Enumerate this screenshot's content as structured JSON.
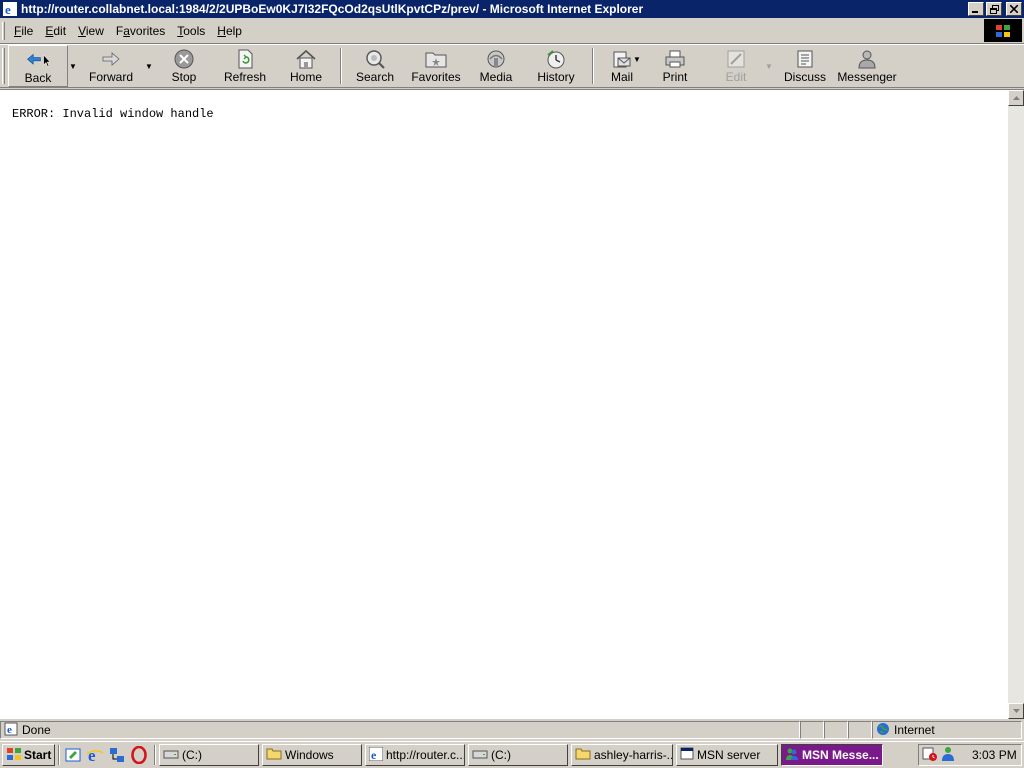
{
  "window": {
    "title": "http://router.collabnet.local:1984/2/2UPBoEw0KJ7I32FQcOd2qsUtlKpvtCPz/prev/ - Microsoft Internet Explorer"
  },
  "menu": {
    "items": [
      {
        "label": "File",
        "accel": "F"
      },
      {
        "label": "Edit",
        "accel": "E"
      },
      {
        "label": "View",
        "accel": "V"
      },
      {
        "label": "Favorites",
        "accel": "a"
      },
      {
        "label": "Tools",
        "accel": "T"
      },
      {
        "label": "Help",
        "accel": "H"
      }
    ]
  },
  "toolbar": {
    "back": "Back",
    "forward": "Forward",
    "stop": "Stop",
    "refresh": "Refresh",
    "home": "Home",
    "search": "Search",
    "favorites": "Favorites",
    "media": "Media",
    "history": "History",
    "mail": "Mail",
    "print": "Print",
    "edit": "Edit",
    "discuss": "Discuss",
    "messenger": "Messenger"
  },
  "page": {
    "message": "ERROR: Invalid window handle"
  },
  "status": {
    "text": "Done",
    "zone": "Internet"
  },
  "taskbar": {
    "start": "Start",
    "tasks": [
      {
        "label": "(C:)",
        "icon": "drive-icon"
      },
      {
        "label": "Windows",
        "icon": "folder-icon"
      },
      {
        "label": "http://router.c...",
        "icon": "ie-icon"
      },
      {
        "label": "(C:)",
        "icon": "drive-icon"
      },
      {
        "label": "ashley-harris-...",
        "icon": "folder-icon"
      },
      {
        "label": "MSN server",
        "icon": "window-icon"
      },
      {
        "label": "MSN Messe...",
        "icon": "msn-icon",
        "active": true
      }
    ],
    "clock": "3:03 PM"
  },
  "colors": {
    "titlebar": "#0a246a",
    "chrome": "#d4d0c8",
    "active_task": "#7a1a8a"
  }
}
